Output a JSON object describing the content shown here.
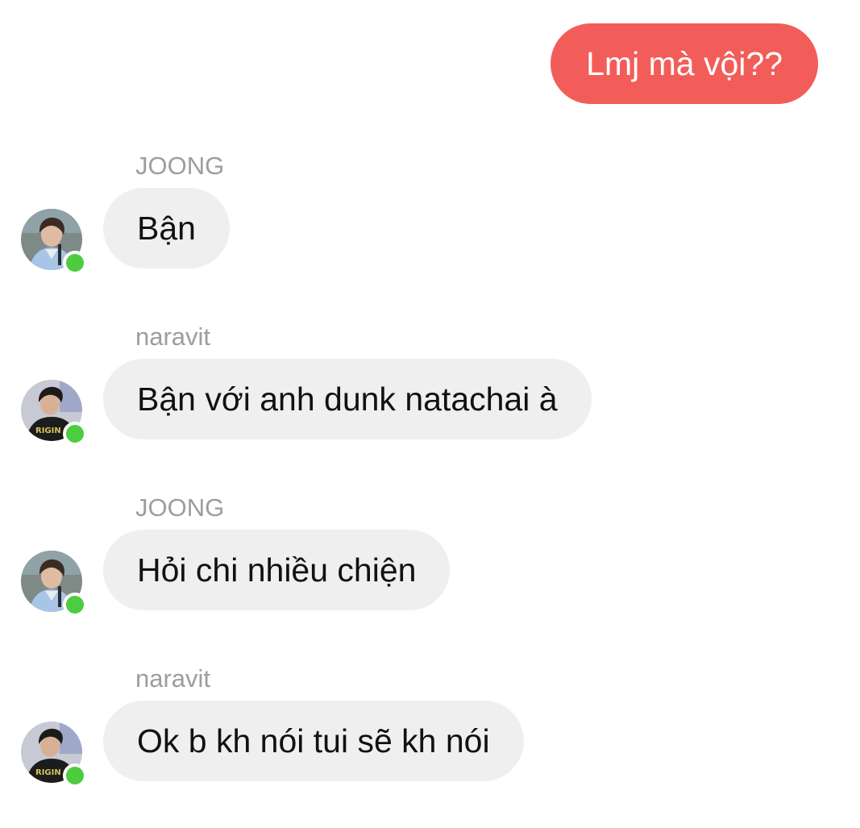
{
  "outgoing_message": {
    "text": "Lmj mà vội??",
    "color": "#f35d59"
  },
  "messages": [
    {
      "sender": "JOONG",
      "text": "Bận",
      "avatar": "avatar-joong",
      "online": true
    },
    {
      "sender": "naravit",
      "text": "Bận với anh dunk natachai à",
      "avatar": "avatar-naravit",
      "online": true
    },
    {
      "sender": "JOONG",
      "text": "Hỏi chi nhiều chiện",
      "avatar": "avatar-joong",
      "online": true
    },
    {
      "sender": "naravit",
      "text": "Ok b kh nói tui sẽ kh nói",
      "avatar": "avatar-naravit",
      "online": true
    }
  ],
  "colors": {
    "incoming_bubble": "#efefef",
    "sender_name": "#9d9d9d",
    "online_dot": "#4ccc3e"
  }
}
